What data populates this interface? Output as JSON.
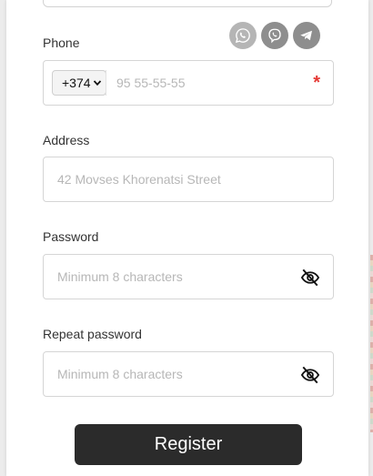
{
  "form": {
    "phone": {
      "label": "Phone",
      "country_code": "+374",
      "placeholder": "95 55-55-55",
      "required_mark": "*",
      "messengers": [
        {
          "name": "whatsapp-icon",
          "color": "#b5b5b5"
        },
        {
          "name": "viber-icon",
          "color": "#8e8e8e"
        },
        {
          "name": "telegram-icon",
          "color": "#8e8e8e"
        }
      ]
    },
    "address": {
      "label": "Address",
      "placeholder": "42 Movses Khorenatsi Street"
    },
    "password": {
      "label": "Password",
      "placeholder": "Minimum 8 characters"
    },
    "repeat_password": {
      "label": "Repeat password",
      "placeholder": "Minimum 8 characters"
    },
    "register_label": "Register"
  },
  "colors": {
    "button": "#2b2b2b",
    "required": "#e53935",
    "border": "#d5d5d5"
  }
}
